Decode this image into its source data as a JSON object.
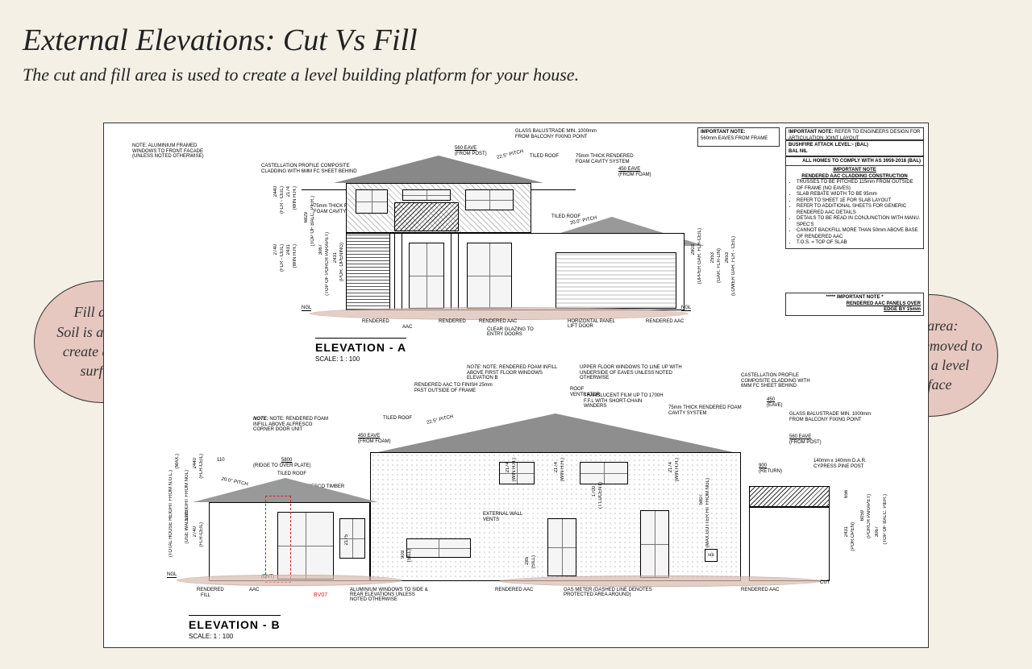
{
  "title": "External Elevations: Cut Vs Fill",
  "subtitle": "The cut and fill area is used to create a level building platform for your house.",
  "bubbles": {
    "fill": "Fill area:\nSoil is added to create a level surface",
    "cut": "Cut area:\nSoil is removed to create a level surface"
  },
  "impnote1": {
    "head": "IMPORTANT NOTE:",
    "body": "560mm EAVES FROM FRAME"
  },
  "impnote2": {
    "head": "IMPORTANT NOTE:",
    "body": "REFER TO ENGINEERS DESIGN FOR ARTICULATION JOINT LAYOUT"
  },
  "bushfire": {
    "line1": "BUSHFIRE ATTACK LEVEL:- (BAL)",
    "line2": "BAL NIL"
  },
  "comply": "ALL HOMES TO COMPLY WITH AS 3959-2018 (BAL)",
  "aac": {
    "head1": "IMPORTANT NOTE",
    "head2": "RENDERED AAC CLADDING CONSTRUCTION",
    "items": [
      "TRUSSES TO BE PITCHED 115mm FROM OUTSIDE OF FRAME (NO EAVES)",
      "SLAB REBATE WIDTH TO BE 95mm",
      "REFER TO SHEET 1E FOR SLAB LAYOUT",
      "REFER TO ADDITIONAL SHEETS FOR GENERIC RENDERED AAC DETAILS",
      "DETAILS TO BE READ IN CONJUNCTION WITH MANU. SPEC'S",
      "CANNOT BACKFILL MORE THAN 50mm ABOVE BASE OF RENDERED AAC",
      "T.O.S. = TOP OF SLAB"
    ],
    "foot1": "***** IMPORTANT NOTE *",
    "foot2": "RENDERED AAC PANELS OVER",
    "foot3": "EDGE BY 15mm"
  },
  "elevA": {
    "title": "ELEVATION - A",
    "scale": "SCALE: 1 : 100",
    "ngl": "NGL",
    "note_alum": "NOTE: ALUMINIUM FRAMED WINDOWS TO FRONT FACADE (UNLESS NOTED OTHERWISE)",
    "note_castell": "CASTELLATION PROFILE COMPOSITE CLADDING WITH 6MM FC SHEET BEHIND",
    "note_foam": "75mm THICK RENDERED FOAM CAVITY SYSTEM",
    "eave560": "560 EAVE",
    "eave560_sub": "(FROM POST)",
    "balustrade": "GLASS BALUSTRADE MIN. 1000mm FROM BALCONY FIXING POINT",
    "tiled": "TILED ROOF",
    "foam75": "75mm THICK RENDERED FOAM CAVITY SYSTEM",
    "eave450": "450 EAVE",
    "eave450_sub": "(FROM FOAM)",
    "pitch225": "22.5° PITCH",
    "pitch20": "20.0° PITCH",
    "eave560b": "560 EAVE",
    "eave560b_sub": "(FROM POST)",
    "dims_left": [
      {
        "v": "2440",
        "s": "(FLR - CEIL)"
      },
      {
        "v": "2174",
        "s": "(WIN H.H.)"
      },
      {
        "v": "2740",
        "s": "(FLR - CEIL)"
      },
      {
        "v": "2431",
        "s": "(WIN H.H.)"
      },
      {
        "v": "6829",
        "s": "(TOP OF BALC. PIER.)"
      },
      {
        "v": "3067",
        "s": "(TOP OF PORCH PARAPET)"
      },
      {
        "v": "2431",
        "s": "(POR. OPENING)"
      }
    ],
    "dims_right": [
      {
        "v": "2803",
        "s": "(UPPER GAR. FLR-CEIL)"
      },
      {
        "v": "2553",
        "s": "(GAR. FLR-LIN)"
      },
      {
        "v": "2653",
        "s": "(LOWER GAR. FLR - CEIL)"
      }
    ],
    "bottom_tags": [
      "RENDERED",
      "AAC",
      "RENDERED",
      "RENDERED AAC",
      "CLEAR GLAZING TO ENTRY DOORS",
      "HORIZONTAL PANEL LIFT DOOR",
      "RENDERED AAC"
    ]
  },
  "elevB": {
    "title": "ELEVATION - B",
    "scale": "SCALE: 1 : 100",
    "note_infill_alfresco": "NOTE: RENDERED FOAM INFILL ABOVE ALFRESCO CORNER DOOR UNIT",
    "note_infill_ff": "NOTE: RENDERED FOAM INFILL ABOVE FIRST FLOOR WINDOWS ELEVATION B",
    "rend_aac_25": "RENDERED AAC TO FINISH 25mm PAST OUTSIDE OF FRAME",
    "tiled": "TILED ROOF",
    "pitch225": "22.5° PITCH",
    "pitch20": "20.0° PITCH",
    "eave450": "450 EAVE",
    "eave450_sub": "(FROM FOAM)",
    "ridge5800": "5800",
    "ridge_sub": "(RIDGE TO OVER PLATE)",
    "tiled_roof2": "TILED ROOF",
    "alfresco": "ALFRESCO TIMBER BEAM",
    "vent": "ROOF VENTILATOR",
    "upper_note": "UPPER FLOOR WINDOWS TO LINE UP WITH UNDERSIDE OF EAVES UNLESS NOTED OTHERWISE",
    "translucent": "TRANSLUCENT FILM UP TO 1700H F.F.L WITH SHORT-CHAIN WINDERS",
    "foam75": "75mm THICK RENDERED FOAM CAVITY SYSTEM",
    "castell": "CASTELLATION PROFILE COMPOSITE CLADDING WITH 6MM FC SHEET BEHIND",
    "return": "900",
    "return_sub": "(RETURN)",
    "eave450b": "450",
    "eave450b_sub": "(EAVE)",
    "balustrade": "GLASS BALUSTRADE MIN. 1000mm FROM BALCONY FIXING POINT",
    "eave560": "560 EAVE",
    "eave560_sub": "(FROM POST)",
    "cypress": "140mm x 140mm D.A.R. CYPRESS PINE POST",
    "wall_vents": "EXTERNAL WALL VENTS",
    "mb": "MB",
    "ent": "(ENT)",
    "d110": "110",
    "dims_left_outer": [
      {
        "v": "",
        "s": "(MAX.)"
      },
      {
        "v": "",
        "s": "(TOTAL HOUSE HEIGHT FROM N.G.L.)"
      }
    ],
    "dims_left": [
      {
        "v": "",
        "s": "(USE WALL HEIGHT FROM NGL)"
      },
      {
        "v": "2440",
        "s": "(FLR-CEIL)"
      },
      {
        "v": "5920",
        "s": ""
      },
      {
        "v": "2740",
        "s": "(FLR-CEIL)"
      }
    ],
    "dims_mid": [
      {
        "v": "2174",
        "s": "(WIN H.H.)"
      },
      {
        "v": "2174",
        "s": "(WIN H.H.)"
      },
      {
        "v": "1700",
        "s": "(T'LUCENT)"
      },
      {
        "v": "2174",
        "s": "(WIN H.H.)"
      },
      {
        "v": "5807",
        "s": "(MAX.GUTTER HT FROM NGL)"
      }
    ],
    "dims_under": [
      {
        "v": "2175",
        "s": ""
      },
      {
        "v": "903",
        "s": "(SILL)"
      },
      {
        "v": "285",
        "s": "(SILL)"
      }
    ],
    "dims_right": [
      {
        "v": "656",
        "s": ""
      },
      {
        "v": "2431",
        "s": "(POR.OPEN)"
      },
      {
        "v": "6059",
        "s": "(PORCH PARAPET)"
      },
      {
        "v": "3067",
        "s": ""
      },
      {
        "v": "",
        "s": "(TOP OF BALC. PIER.)"
      }
    ],
    "bottom_tags": [
      "RENDERED",
      "FILL",
      "AAC",
      "ALUMINIUM WINDOWS TO SIDE & REAR ELEVATIONS UNLESS NOTED OTHERWISE",
      "RENDERED AAC",
      "GAS METER (DASHED LINE DENOTES PROTECTED AREA AROUND)",
      "RENDERED AAC",
      "CUT"
    ],
    "bv": "BV07",
    "ngl": "NGL"
  }
}
